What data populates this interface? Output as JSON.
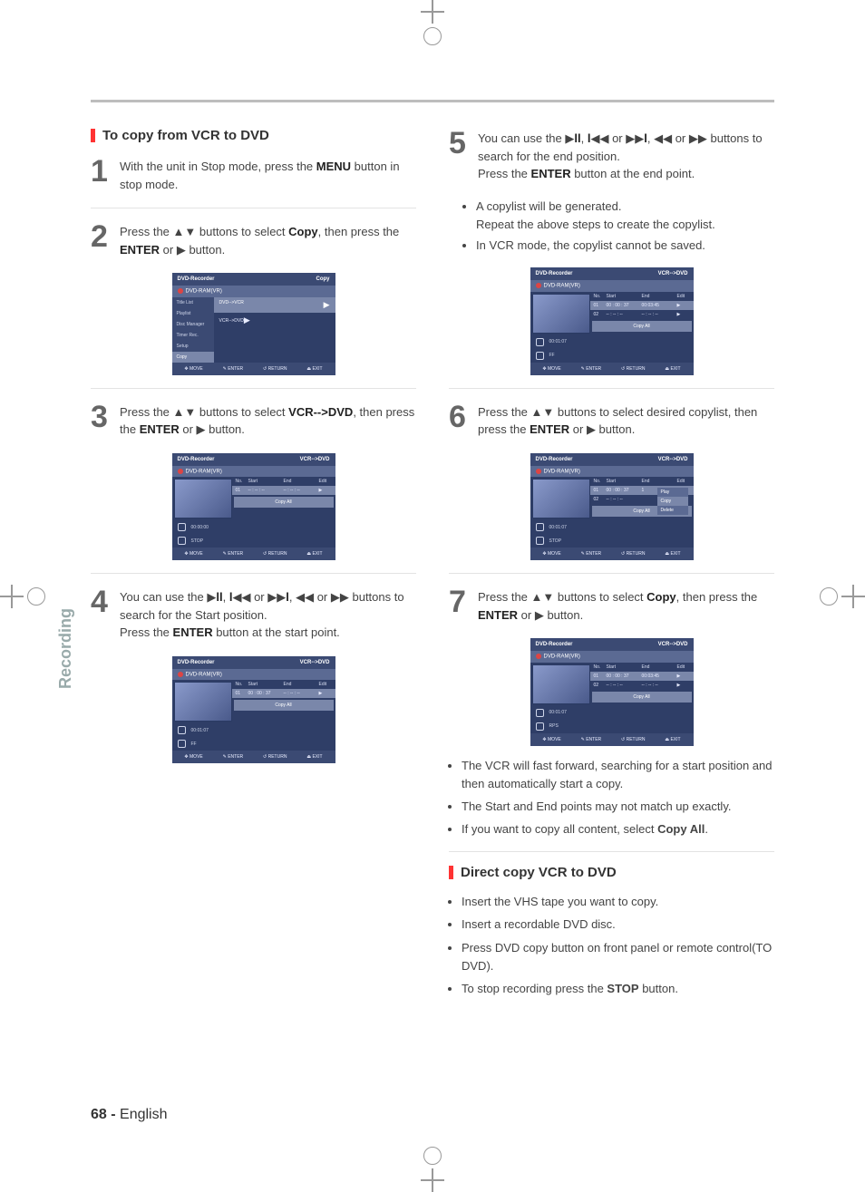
{
  "sidebar_label": "Recording",
  "page_number": "68 -",
  "page_lang": "English",
  "sec1": {
    "title": "To copy from VCR to DVD",
    "steps": {
      "s1": {
        "n": "1",
        "html": "With the unit in Stop mode, press the <b>MENU</b> button in stop mode."
      },
      "s2": {
        "n": "2",
        "html": "Press the ▲▼  buttons to select <b>Copy</b>, then press the <b>ENTER</b> or ▶ button."
      },
      "s3": {
        "n": "3",
        "html": "Press the ▲▼ buttons to select <b>VCR--&gt;DVD</b>, then press the <b>ENTER</b> or ▶ button."
      },
      "s4": {
        "n": "4",
        "html": "You can use the ▶<b>ll</b>, <b>l</b>◀◀ or ▶▶<b>l</b>, ◀◀ or ▶▶ buttons to search for the Start position.<br>Press the <b>ENTER</b> button at the start point."
      },
      "s5": {
        "n": "5",
        "html": "You can use the ▶<b>ll</b>, <b>l</b>◀◀ or ▶▶<b>l</b>, ◀◀ or ▶▶ buttons to search for the end position.<br>Press the <b>ENTER</b> button at the end point."
      },
      "s5_bullets": [
        "A copylist will be generated.<br>Repeat the above steps to create the copylist.",
        "In VCR mode, the copylist cannot be saved."
      ],
      "s6": {
        "n": "6",
        "html": "Press the ▲▼ buttons to select desired copylist, then press the <b>ENTER</b> or ▶ button."
      },
      "s7": {
        "n": "7",
        "html": "Press the ▲▼ buttons to select <b>Copy</b>, then press the <b>ENTER</b> or ▶ button."
      },
      "s7_bullets": [
        "The VCR will fast forward, searching for a start position and then automatically start a copy.",
        "The Start and End points may not match up exactly.",
        "If you want to copy all content, select <b>Copy All</b>."
      ]
    }
  },
  "sec2": {
    "title": "Direct copy VCR to DVD",
    "bullets": [
      "Insert the VHS tape you want to copy.",
      "Insert a recordable DVD disc.",
      "Press DVD copy button on front panel or remote control(TO DVD).",
      "To stop recording press the <b>STOP</b> button."
    ]
  },
  "osd_common": {
    "title": "DVD-Recorder",
    "sub": "DVD-RAM(VR)",
    "foot": {
      "move": "MOVE",
      "enter": "ENTER",
      "return": "RETURN",
      "exit": "EXIT"
    },
    "copyall": "Copy All",
    "th": {
      "no": "No.",
      "start": "Start",
      "end": "End",
      "edit": "Edit"
    }
  },
  "osd2": {
    "mode": "Copy",
    "menu": [
      "Title List",
      "Playlist",
      "Disc Manager",
      "Timer Rec.",
      "Setup",
      "Copy"
    ],
    "sel_index": 5,
    "right": [
      {
        "label": "DVD-->VCR",
        "arrow": "▶",
        "sel": true
      },
      {
        "label": "VCR-->DVD",
        "arrow": "▶",
        "sel": false
      }
    ]
  },
  "osd3": {
    "mode": "VCR-->DVD",
    "rows": [
      {
        "no": "01",
        "start": "-- : -- : --",
        "end": "-- : -- : --",
        "edit": "▶",
        "sel": true
      }
    ],
    "time": "00:00:00",
    "state": "STOP"
  },
  "osd4": {
    "mode": "VCR-->DVD",
    "rows": [
      {
        "no": "01",
        "start": "00 : 00 : 37",
        "end": "-- : -- : --",
        "edit": "▶",
        "sel": true
      }
    ],
    "time": "00:01:07",
    "state": "FF"
  },
  "osd5": {
    "mode": "VCR-->DVD",
    "rows": [
      {
        "no": "01",
        "start": "00 : 00 : 37",
        "end": "00:03:45",
        "edit": "▶",
        "sel": true
      },
      {
        "no": "02",
        "start": "-- : -- : --",
        "end": "-- : -- : --",
        "edit": "▶",
        "sel": false
      }
    ],
    "time": "00:01:07",
    "state": "FF"
  },
  "osd6": {
    "mode": "VCR-->DVD",
    "rows": [
      {
        "no": "01",
        "start": "00 : 00 : 37",
        "end": "1",
        "edit": "",
        "sel": true
      },
      {
        "no": "02",
        "start": "-- : -- : --",
        "end": "",
        "edit": "",
        "sel": false
      }
    ],
    "popup": [
      "Play",
      "Copy",
      "Delete"
    ],
    "popup_sel": 1,
    "time": "00:01:07",
    "state": "STOP"
  },
  "osd7": {
    "mode": "VCR-->DVD",
    "rows": [
      {
        "no": "01",
        "start": "00 : 00 : 37",
        "end": "00:03:45",
        "edit": "▶",
        "sel": true
      },
      {
        "no": "02",
        "start": "-- : -- : --",
        "end": "-- : -- : --",
        "edit": "▶",
        "sel": false
      }
    ],
    "time": "00:01:07",
    "state": "RPS"
  }
}
